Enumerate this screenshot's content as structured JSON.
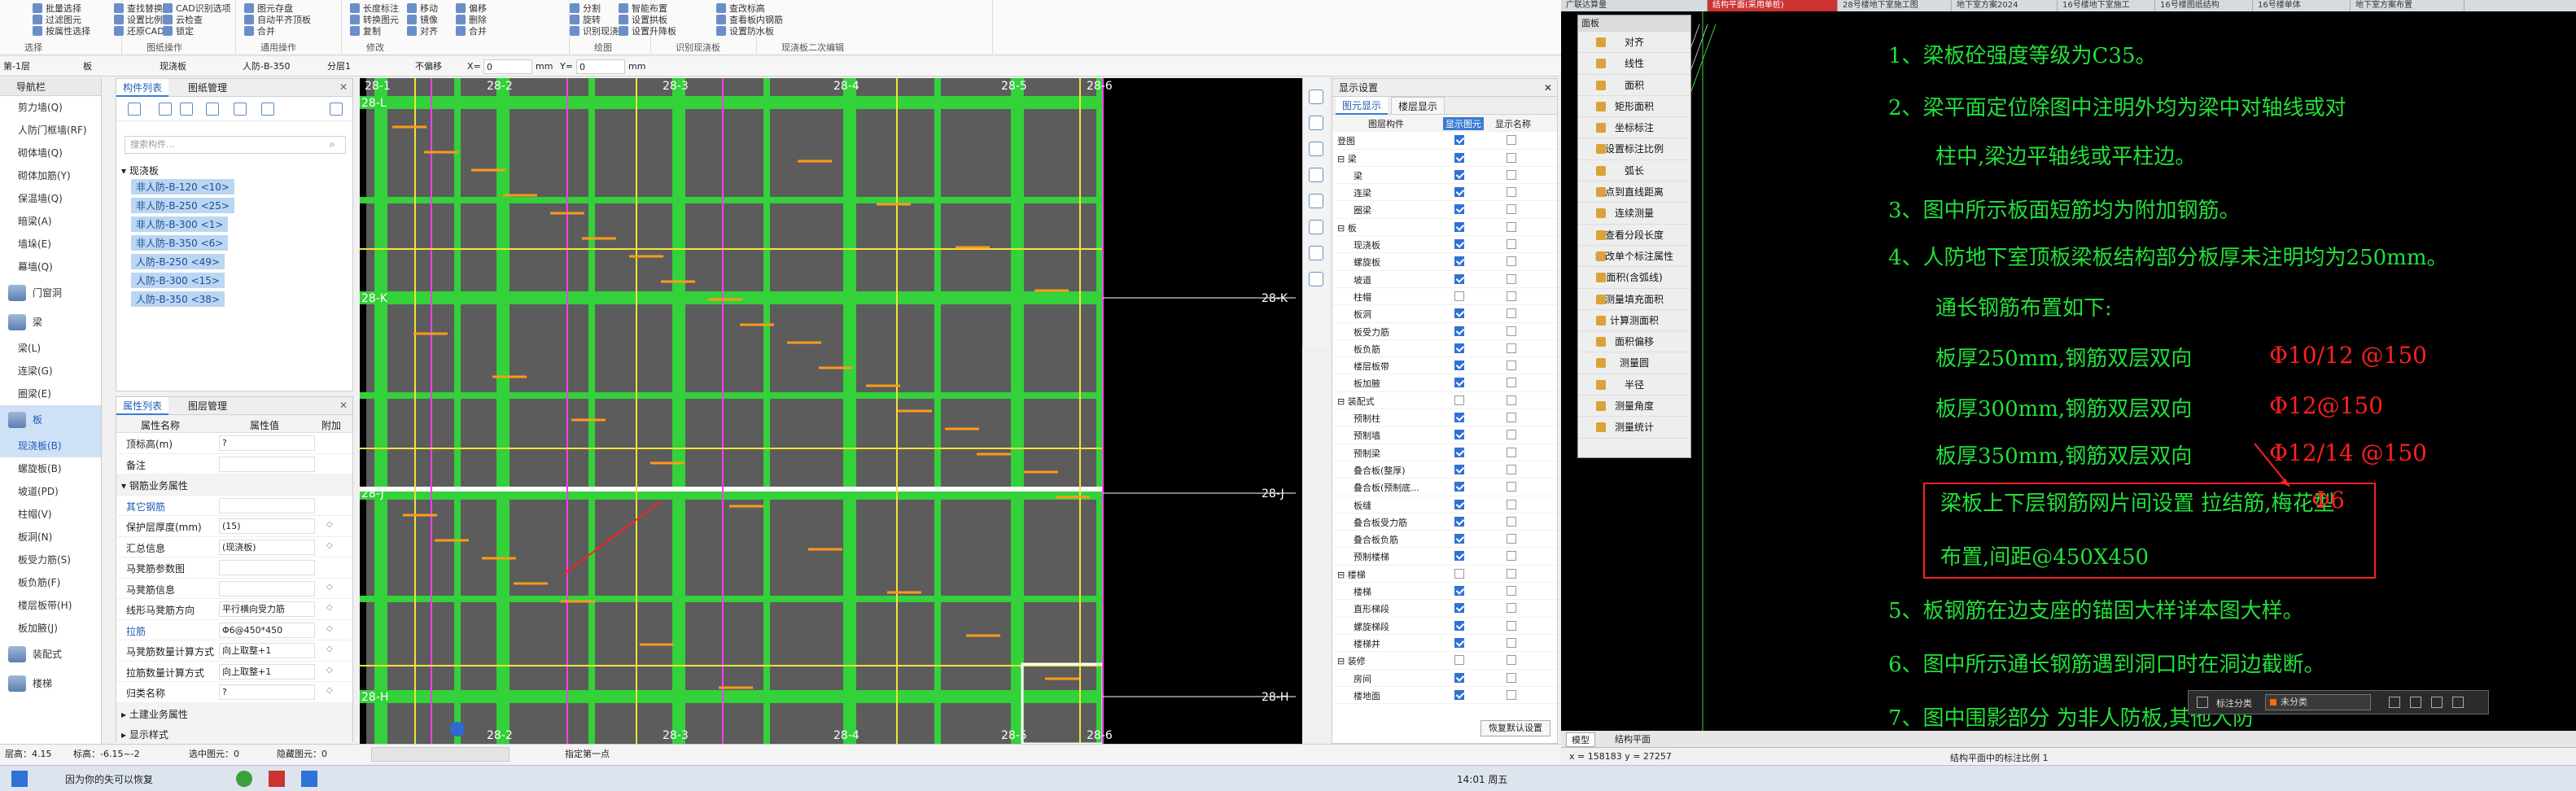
{
  "ribbon": {
    "items": [
      "批量选择",
      "过滤图元",
      "按属性选择",
      "查找替换",
      "设置比例",
      "还原CAD",
      "CAD识别选项",
      "云检查",
      "锁定",
      "图元存盘",
      "自动平齐顶板",
      "合并",
      "长度标注",
      "转换图元",
      "复制",
      "移动",
      "镜像",
      "对齐",
      "偏移",
      "删除",
      "合并",
      "分割",
      "旋转",
      "识别现浇板",
      "智能布置",
      "设置拱板",
      "设置升降板",
      "查改标高",
      "查看板内钢筋",
      "设置防水板"
    ],
    "group_labels": [
      "选择",
      "图纸操作",
      "通用操作",
      "修改",
      "绘图",
      "识别现浇板",
      "现浇板二次编辑"
    ]
  },
  "floorbar": {
    "floor": "第-1层",
    "type": "板",
    "subtype": "现浇板",
    "component": "人防-B-350",
    "layer": "分层1",
    "offset": "不偏移",
    "x": "0",
    "y": "0",
    "unit": "mm"
  },
  "nav": {
    "title": "导航栏",
    "items": [
      {
        "label": "剪力墙(Q)",
        "big": false
      },
      {
        "label": "人防门框墙(RF)",
        "big": false
      },
      {
        "label": "砌体墙(Q)",
        "big": false
      },
      {
        "label": "砌体加筋(Y)",
        "big": false
      },
      {
        "label": "保温墙(Q)",
        "big": false
      },
      {
        "label": "暗梁(A)",
        "big": false
      },
      {
        "label": "墙垛(E)",
        "big": false
      },
      {
        "label": "幕墙(Q)",
        "big": false
      },
      {
        "label": "门窗洞",
        "big": true
      },
      {
        "label": "梁",
        "big": true
      },
      {
        "label": "梁(L)",
        "big": false
      },
      {
        "label": "连梁(G)",
        "big": false
      },
      {
        "label": "圈梁(E)",
        "big": false
      },
      {
        "label": "板",
        "big": true,
        "sel": true
      },
      {
        "label": "现浇板(B)",
        "big": false,
        "sel": true
      },
      {
        "label": "螺旋板(B)",
        "big": false
      },
      {
        "label": "坡道(PD)",
        "big": false
      },
      {
        "label": "柱帽(V)",
        "big": false
      },
      {
        "label": "板洞(N)",
        "big": false
      },
      {
        "label": "板受力筋(S)",
        "big": false
      },
      {
        "label": "板负筋(F)",
        "big": false
      },
      {
        "label": "楼层板带(H)",
        "big": false
      },
      {
        "label": "板加腋(J)",
        "big": false
      },
      {
        "label": "装配式",
        "big": true
      },
      {
        "label": "楼梯",
        "big": true
      }
    ]
  },
  "components": {
    "tabs": [
      "构件列表",
      "图纸管理"
    ],
    "search_placeholder": "搜索构件...",
    "group": "现浇板",
    "items": [
      "非人防-B-120 <10>",
      "非人防-B-250 <25>",
      "非人防-B-300 <1>",
      "非人防-B-350 <6>",
      "人防-B-250 <49>",
      "人防-B-300 <15>",
      "人防-B-350 <38>"
    ]
  },
  "props": {
    "tabs": [
      "属性列表",
      "图层管理"
    ],
    "headers": [
      "属性名称",
      "属性值",
      "附加"
    ],
    "rows": [
      {
        "k": "顶标高(m)",
        "v": "?",
        "a": ""
      },
      {
        "k": "备注",
        "v": "",
        "a": ""
      },
      {
        "k": "▾ 钢筋业务属性",
        "v": "",
        "a": "",
        "head": true
      },
      {
        "k": "其它钢筋",
        "v": "",
        "a": "",
        "blue": true
      },
      {
        "k": "保护层厚度(mm)",
        "v": "(15)",
        "a": "◇"
      },
      {
        "k": "汇总信息",
        "v": "(现浇板)",
        "a": "◇"
      },
      {
        "k": "马凳筋参数图",
        "v": "",
        "a": ""
      },
      {
        "k": "马凳筋信息",
        "v": "",
        "a": "◇"
      },
      {
        "k": "线形马凳筋方向",
        "v": "平行横向受力筋",
        "a": "◇"
      },
      {
        "k": "拉筋",
        "v": "Φ6@450*450",
        "a": "◇",
        "blue": true
      },
      {
        "k": "马凳筋数量计算方式",
        "v": "向上取整+1",
        "a": "◇"
      },
      {
        "k": "拉筋数量计算方式",
        "v": "向上取整+1",
        "a": "◇"
      },
      {
        "k": "归类名称",
        "v": "?",
        "a": "◇"
      },
      {
        "k": "▸ 土建业务属性",
        "v": "",
        "a": "",
        "head": true
      },
      {
        "k": "▸ 显示样式",
        "v": "",
        "a": "",
        "head": true
      }
    ]
  },
  "canvas": {
    "axes_top": [
      "28-1",
      "28-2",
      "28-3",
      "28-4",
      "28-5",
      "28-6"
    ],
    "axes_bottom": [
      "28-2",
      "28-3",
      "28-4",
      "28-5",
      "28-6"
    ],
    "axes_left": [
      "28-L",
      "28-K",
      "28-J",
      "28-H"
    ],
    "axes_right": [
      "28-K",
      "28-J",
      "28-H"
    ]
  },
  "display": {
    "title": "显示设置",
    "tabs": [
      "图元显示",
      "楼层显示"
    ],
    "headers": [
      "图层构件",
      "显示图元",
      "显示名称"
    ],
    "rows": [
      {
        "n": "登图",
        "lvl": 0,
        "a": true,
        "b": false
      },
      {
        "n": "梁",
        "lvl": 0,
        "a": true,
        "b": false,
        "grp": true
      },
      {
        "n": "梁",
        "lvl": 1,
        "a": true,
        "b": false
      },
      {
        "n": "连梁",
        "lvl": 1,
        "a": true,
        "b": false
      },
      {
        "n": "圈梁",
        "lvl": 1,
        "a": true,
        "b": false
      },
      {
        "n": "板",
        "lvl": 0,
        "a": true,
        "b": false,
        "grp": true
      },
      {
        "n": "现浇板",
        "lvl": 1,
        "a": true,
        "b": false
      },
      {
        "n": "螺旋板",
        "lvl": 1,
        "a": true,
        "b": false
      },
      {
        "n": "坡道",
        "lvl": 1,
        "a": true,
        "b": false
      },
      {
        "n": "柱帽",
        "lvl": 1,
        "a": false,
        "b": false
      },
      {
        "n": "板洞",
        "lvl": 1,
        "a": true,
        "b": false
      },
      {
        "n": "板受力筋",
        "lvl": 1,
        "a": true,
        "b": false
      },
      {
        "n": "板负筋",
        "lvl": 1,
        "a": true,
        "b": false
      },
      {
        "n": "楼层板带",
        "lvl": 1,
        "a": true,
        "b": false
      },
      {
        "n": "板加腋",
        "lvl": 1,
        "a": true,
        "b": false
      },
      {
        "n": "装配式",
        "lvl": 0,
        "a": false,
        "b": false,
        "grp": true
      },
      {
        "n": "预制柱",
        "lvl": 1,
        "a": true,
        "b": false
      },
      {
        "n": "预制墙",
        "lvl": 1,
        "a": true,
        "b": false
      },
      {
        "n": "预制梁",
        "lvl": 1,
        "a": true,
        "b": false
      },
      {
        "n": "叠合板(整厚)",
        "lvl": 1,
        "a": true,
        "b": false
      },
      {
        "n": "叠合板(预制底...",
        "lvl": 1,
        "a": true,
        "b": false
      },
      {
        "n": "板缝",
        "lvl": 1,
        "a": true,
        "b": false
      },
      {
        "n": "叠合板受力筋",
        "lvl": 1,
        "a": true,
        "b": false
      },
      {
        "n": "叠合板负筋",
        "lvl": 1,
        "a": true,
        "b": false
      },
      {
        "n": "预制楼梯",
        "lvl": 1,
        "a": true,
        "b": false
      },
      {
        "n": "楼梯",
        "lvl": 0,
        "a": false,
        "b": false,
        "grp": true
      },
      {
        "n": "楼梯",
        "lvl": 1,
        "a": true,
        "b": false
      },
      {
        "n": "直形梯段",
        "lvl": 1,
        "a": true,
        "b": false
      },
      {
        "n": "螺旋梯段",
        "lvl": 1,
        "a": true,
        "b": false
      },
      {
        "n": "楼梯井",
        "lvl": 1,
        "a": true,
        "b": false
      },
      {
        "n": "装修",
        "lvl": 0,
        "a": false,
        "b": false,
        "grp": true
      },
      {
        "n": "房间",
        "lvl": 1,
        "a": true,
        "b": false
      },
      {
        "n": "楼地面",
        "lvl": 1,
        "a": true,
        "b": false
      }
    ],
    "restore": "恢复默认设置"
  },
  "statusL": {
    "floor_h": "层高：4.15",
    "elev": "标高：-6.15~-2",
    "selected": "选中图元：0",
    "hidden": "隐藏图元：0",
    "snap": "指定第一点"
  },
  "right": {
    "tabs": [
      "广联达算量",
      "结构平面(采用单桩)",
      "28号楼地下室施工图",
      "地下室方案2024",
      "16号楼地下室施工",
      "16号楼图纸结构",
      "16号楼单体",
      "地下室方案布置"
    ],
    "menu_title": "面板",
    "menu": [
      "对齐",
      "线性",
      "面积",
      "矩形面积",
      "坐标标注",
      "设置标注比例",
      "弧长",
      "点到直线距离",
      "连续测量",
      "查看分段长度",
      "绘改单个标注属性",
      "面积(含弧线)",
      "测量填充面积",
      "计算测面积",
      "面积偏移",
      "测量圆",
      "半径",
      "测量角度",
      "测量统计"
    ],
    "notes": [
      "1、梁板砼强度等级为C35。",
      "2、梁平面定位除图中注明外均为梁中对轴线或对",
      "柱中,梁边平轴线或平柱边。",
      "3、图中所示板面短筋均为附加钢筋。",
      "4、人防地下室顶板梁板结构部分板厚未注明均为250mm。",
      "通长钢筋布置如下:",
      "板厚250mm,钢筋双层双向",
      "板厚300mm,钢筋双层双向",
      "板厚350mm,钢筋双层双向",
      "梁板上下层钢筋网片间设置     拉结筋,梅花型",
      "布置,间距@450X450",
      "5、板钢筋在边支座的锚固大样详本图大样。",
      "6、图中所示通长钢筋遇到洞口时在洞边截断。",
      "7、图中围影部分        为非人防板,其他人防"
    ],
    "rebar": [
      "Φ10/12 @150",
      "Φ12@150",
      "Φ12/14 @150",
      "Φ6"
    ],
    "float_label": "标注分类",
    "float_value": "未分类",
    "model_tab": "模型",
    "layout_tab": "结构平面",
    "coords": "x = 158183  y = 27257",
    "status": "结构平面中的标注比例 1"
  },
  "taskbar": {
    "time": "14:01 周五",
    "app": "因为你的失可以恢复"
  }
}
